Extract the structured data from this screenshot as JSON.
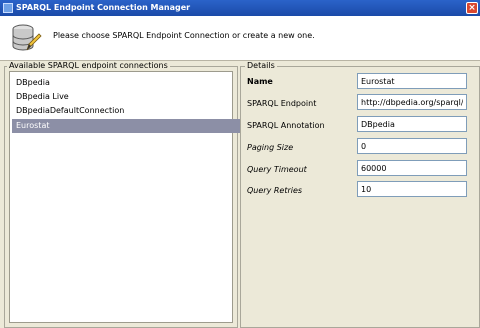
{
  "window": {
    "title": "SPARQL Endpoint Connection Manager",
    "close_glyph": "×"
  },
  "header": {
    "instruction": "Please choose SPARQL Endpoint Connection or create a new one."
  },
  "connections": {
    "legend": "Available SPARQL endpoint connections",
    "items": [
      "DBpedia",
      "DBpedia Live",
      "DBpediaDefaultConnection",
      "Eurostat"
    ],
    "selected": "Eurostat"
  },
  "details": {
    "legend": "Details",
    "fields": {
      "name": {
        "label": "Name",
        "value": "Eurostat"
      },
      "endpoint": {
        "label": "SPARQL Endpoint",
        "value": "http://dbpedia.org/sparql/"
      },
      "annotation": {
        "label": "SPARQL Annotation",
        "value": "DBpedia"
      },
      "paging_size": {
        "label": "Paging Size",
        "value": "0"
      },
      "query_timeout": {
        "label": "Query Timeout",
        "value": "60000"
      },
      "query_retries": {
        "label": "Query Retries",
        "value": "10"
      }
    }
  },
  "colors": {
    "titlebar": "#1a4aa8",
    "selection": "#8c8fa6",
    "dialog_bg": "#ece9d8"
  },
  "icons": {
    "app": "app-icon",
    "header": "database-edit-icon",
    "close": "close-icon"
  }
}
